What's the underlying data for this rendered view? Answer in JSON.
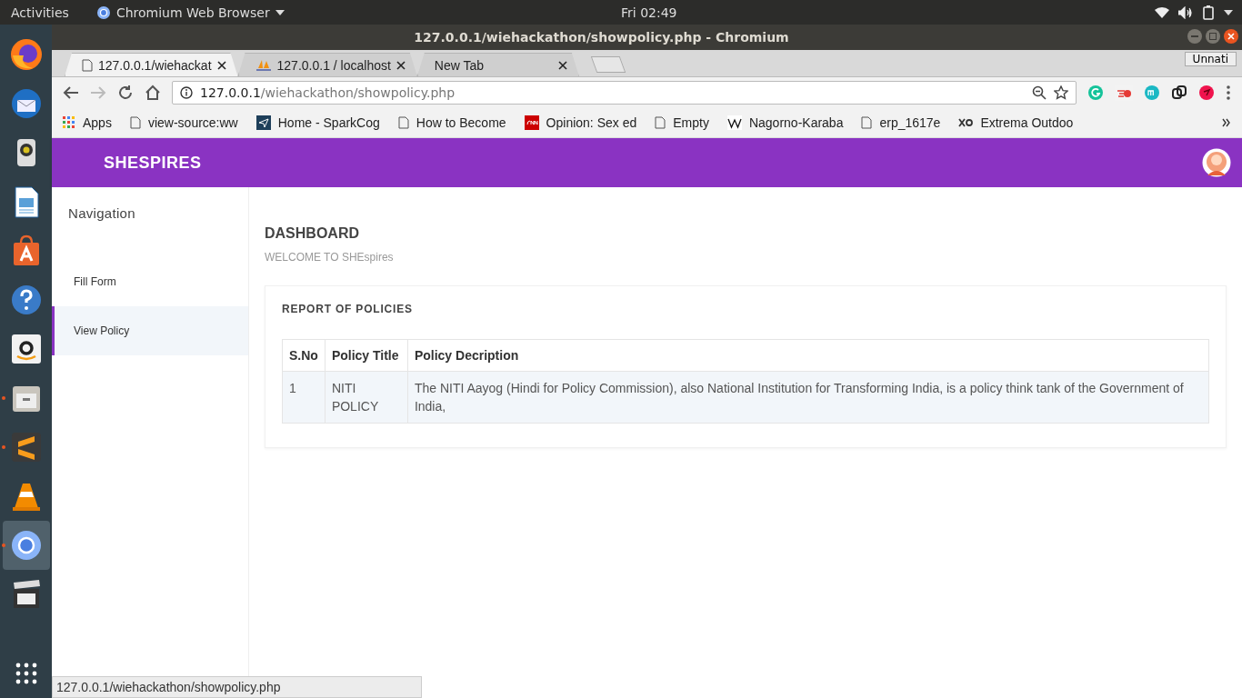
{
  "top_bar": {
    "activities": "Activities",
    "app_menu": "Chromium Web Browser",
    "clock": "Fri 02:49"
  },
  "dock": [
    {
      "kind": "firefox",
      "running": false,
      "selected": false
    },
    {
      "kind": "mail",
      "running": false,
      "selected": false
    },
    {
      "kind": "speaker",
      "running": false,
      "selected": false
    },
    {
      "kind": "writer",
      "running": false,
      "selected": false
    },
    {
      "kind": "store",
      "running": false,
      "selected": false
    },
    {
      "kind": "help",
      "running": false,
      "selected": false
    },
    {
      "kind": "amazon",
      "running": false,
      "selected": false
    },
    {
      "kind": "files",
      "running": true,
      "selected": false
    },
    {
      "kind": "sublime",
      "running": true,
      "selected": false
    },
    {
      "kind": "vlc",
      "running": false,
      "selected": false
    },
    {
      "kind": "chromium",
      "running": true,
      "selected": true
    },
    {
      "kind": "clapper",
      "running": false,
      "selected": false
    }
  ],
  "window": {
    "title": "127.0.0.1/wiehackathon/showpolicy.php - Chromium",
    "profile": "Unnati"
  },
  "tabs": [
    {
      "label": "127.0.0.1/wiehackat",
      "kind": "page",
      "selected": true
    },
    {
      "label": "127.0.0.1 / localhost",
      "kind": "pma",
      "selected": false
    },
    {
      "label": "New Tab",
      "kind": "none",
      "selected": false
    }
  ],
  "address": {
    "host": "127.0.0.1",
    "path": "/wiehackathon/showpolicy.php"
  },
  "bookmarks": [
    {
      "label": "Apps",
      "kind": "apps"
    },
    {
      "label": "view-source:ww",
      "kind": "page"
    },
    {
      "label": "Home - SparkCog",
      "kind": "spark"
    },
    {
      "label": "How to Become",
      "kind": "page"
    },
    {
      "label": "Opinion: Sex ed",
      "kind": "cnn"
    },
    {
      "label": "Empty",
      "kind": "page"
    },
    {
      "label": "Nagorno-Karaba",
      "kind": "wiki"
    },
    {
      "label": "erp_1617e",
      "kind": "page"
    },
    {
      "label": "Extrema Outdoo",
      "kind": "xo"
    }
  ],
  "site": {
    "brand": "SHESPIRES",
    "nav_heading": "Navigation",
    "nav": [
      {
        "label": "Fill Form",
        "selected": false
      },
      {
        "label": "View Policy",
        "selected": true
      }
    ],
    "heading": "DASHBOARD",
    "subheading": "WELCOME TO SHEspires",
    "card_title": "REPORT OF POLICIES",
    "table": {
      "columns": [
        "S.No",
        "Policy Title",
        "Policy Decription"
      ],
      "rows": [
        [
          "1",
          "NITI POLICY",
          "The NITI Aayog (Hindi for Policy Commission), also National Institution for Transforming India, is a policy think tank of the Government of India,"
        ]
      ]
    }
  },
  "status_bubble": "127.0.0.1/wiehackathon/showpolicy.php"
}
